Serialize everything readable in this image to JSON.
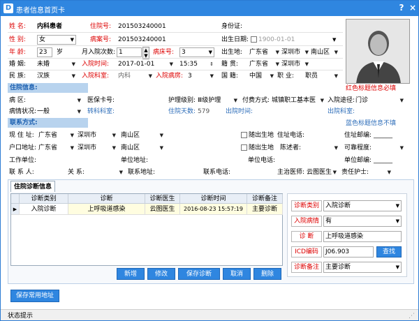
{
  "window": {
    "title": "患者信息首页卡",
    "help": "?",
    "close": "×"
  },
  "basic": {
    "name_label": "姓  名:",
    "name_value": "内科患者",
    "inpatient_no_label": "住院号:",
    "inpatient_no_value": "201503240001",
    "id_card_label": "身份证:",
    "gender_label": "性  别:",
    "gender_value": "女",
    "case_no_label": "病案号:",
    "case_no_value": "201503240001",
    "birth_label": "出生日期:",
    "birth_value": "1900-01-01",
    "age_label": "年  龄:",
    "age_value": "23",
    "age_unit": "岁",
    "admit_count_label": "月入院次数:",
    "admit_count_value": "1",
    "bed_label": "病床号:",
    "bed_value": "3",
    "birthplace_label": "出生地:",
    "birthplace_province": "广东省",
    "birthplace_city": "深圳市",
    "birthplace_district": "南山区",
    "marriage_label": "婚  姻:",
    "marriage_value": "未婚",
    "admit_time_label": "入院时间:",
    "admit_date": "2017-01-01",
    "admit_time": "15:35",
    "native_label": "籍  贯:",
    "native_province": "广东省",
    "native_city": "深圳市",
    "nation_label": "民  族:",
    "nation_value": "汉族",
    "dept_label": "入院科室:",
    "dept_value": "内科",
    "ward_label": "入院病房:",
    "ward_value": "3",
    "nationality_label": "国  籍:",
    "nationality_value": "中国",
    "job_label": "职  业:",
    "job_value": "职员"
  },
  "inpatient_section": {
    "title": "住院信息:",
    "note": "红色标题信息必填",
    "area_label": "病  区:",
    "medcard_label": "医保卡号:",
    "care_label": "护理级别:",
    "care_value": "Ⅲ级护理",
    "payment_label": "付费方式:",
    "payment_value": "城镇职工基本医",
    "route_label": "入院途径:",
    "route_value": "门诊",
    "condition_label": "病情状况:",
    "condition_value": "一般",
    "transfer_label": "转科科室:",
    "days_label": "住院天数:",
    "days_value": "579",
    "discharge_time_label": "出院时间:",
    "discharge_dept_label": "出院科室:"
  },
  "contact_section": {
    "title": "联系方式:",
    "note": "蓝色标题信息不填",
    "address_label": "现 住 址:",
    "address_province": "广东省",
    "address_city": "深圳市",
    "address_district": "南山区",
    "same_birth_label": "随出生地",
    "address_phone_label": "住址电话:",
    "address_zip_label": "住址邮编:",
    "address_zip_value": "______",
    "hukou_label": "户口地址:",
    "hukou_province": "广东省",
    "hukou_city": "深圳市",
    "hukou_district": "南山区",
    "same_birth_label2": "随出生地",
    "narrator_label": "陈述者:",
    "reliability_label": "可靠程度:",
    "workplace_label": "工作单位:",
    "work_address_label": "单位地址:",
    "work_phone_label": "单位电话:",
    "work_zip_label": "单位邮编:",
    "work_zip_value": "______",
    "contact_label": "联 系 人:",
    "relation_label": "关  系:",
    "contact_address_label": "联系地址:",
    "contact_phone_label": "联系电话:",
    "doctor_label": "主治医师:",
    "doctor_value": "云图医生",
    "nurse_label": "责任护士:"
  },
  "diagnosis": {
    "tab_label": "住院诊断信息",
    "columns": [
      "诊断类别",
      "诊断",
      "诊断医生",
      "诊断时间",
      "诊断备注"
    ],
    "rows": [
      {
        "type": "入院诊断",
        "diagnosis": "上呼吸道感染",
        "doctor": "云图医生",
        "time": "2016-08-23 15:57:19",
        "remark": "主要诊断"
      }
    ],
    "buttons": {
      "add": "新增",
      "edit": "修改",
      "save": "保存诊断",
      "cancel": "取消",
      "delete": "删除"
    },
    "form": {
      "type_label": "诊断类别",
      "type_value": "入院诊断",
      "condition_label": "入院病情",
      "condition_value": "有",
      "diag_label": "诊  断",
      "diag_value": "上呼吸道感染",
      "icd_label": "ICD编码",
      "icd_value": "J06.903",
      "search_label": "查找",
      "remark_label": "诊断备注",
      "remark_value": "主要诊断"
    }
  },
  "footer": {
    "save_address": "保存常用地址",
    "status": "状态提示"
  }
}
